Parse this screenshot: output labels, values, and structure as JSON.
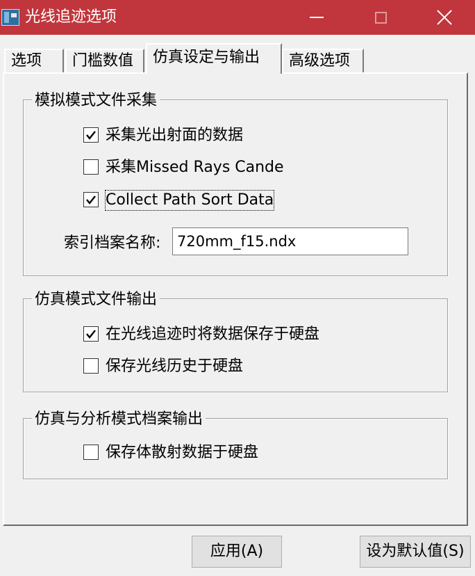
{
  "window": {
    "title": "光线追迹选项"
  },
  "tabs": [
    {
      "label": "选项",
      "active": false
    },
    {
      "label": "门槛数值",
      "active": false
    },
    {
      "label": "仿真设定与输出",
      "active": true
    },
    {
      "label": "高级选项",
      "active": false
    }
  ],
  "group_sim_file_collect": {
    "title": "模拟模式文件采集",
    "checkboxes": [
      {
        "label": "采集光出射面的数据",
        "checked": true
      },
      {
        "label": "采集Missed Rays Cande",
        "checked": false
      },
      {
        "label": "Collect Path Sort Data",
        "checked": true
      }
    ],
    "index_file_label": "索引档案名称:",
    "index_file_value": "720mm_f15.ndx"
  },
  "group_sim_file_output": {
    "title": "仿真模式文件输出",
    "checkboxes": [
      {
        "label": "在光线追迹时将数据保存于硬盘",
        "checked": true
      },
      {
        "label": "保存光线历史于硬盘",
        "checked": false
      }
    ]
  },
  "group_analysis_output": {
    "title": "仿真与分析模式档案输出",
    "checkboxes": [
      {
        "label": "保存体散射数据于硬盘",
        "checked": false
      }
    ]
  },
  "buttons": {
    "apply": "应用(A)",
    "set_default": "设为默认值(S)"
  }
}
